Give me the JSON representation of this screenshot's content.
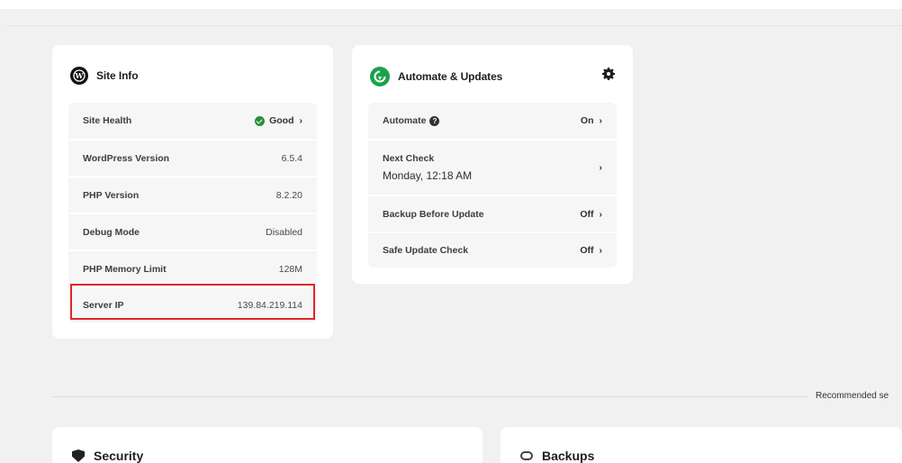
{
  "site_info": {
    "title": "Site Info",
    "rows": [
      {
        "label": "Site Health",
        "value": "Good",
        "chevron": "›"
      },
      {
        "label": "WordPress Version",
        "value": "6.5.4"
      },
      {
        "label": "PHP Version",
        "value": "8.2.20"
      },
      {
        "label": "Debug Mode",
        "value": "Disabled"
      },
      {
        "label": "PHP Memory Limit",
        "value": "128M"
      },
      {
        "label": "Server IP",
        "value": "139.84.219.114"
      }
    ],
    "highlight_color": "#e3242b"
  },
  "automate": {
    "title": "Automate & Updates",
    "rows": [
      {
        "label": "Automate",
        "value": "On",
        "chevron": "›"
      },
      {
        "label": "Next Check",
        "sub": "Monday, 12:18 AM",
        "chevron": "›"
      },
      {
        "label": "Backup Before Update",
        "value": "Off",
        "chevron": "›"
      },
      {
        "label": "Safe Update Check",
        "value": "Off",
        "chevron": "›"
      }
    ]
  },
  "recommended": {
    "label": "Recommended se"
  },
  "bottom": {
    "security_title": "Security",
    "backups_title": "Backups"
  },
  "colors": {
    "good": "#2a8f3c",
    "accent_green": "#1aa34a",
    "background": "#f1f1f1"
  }
}
